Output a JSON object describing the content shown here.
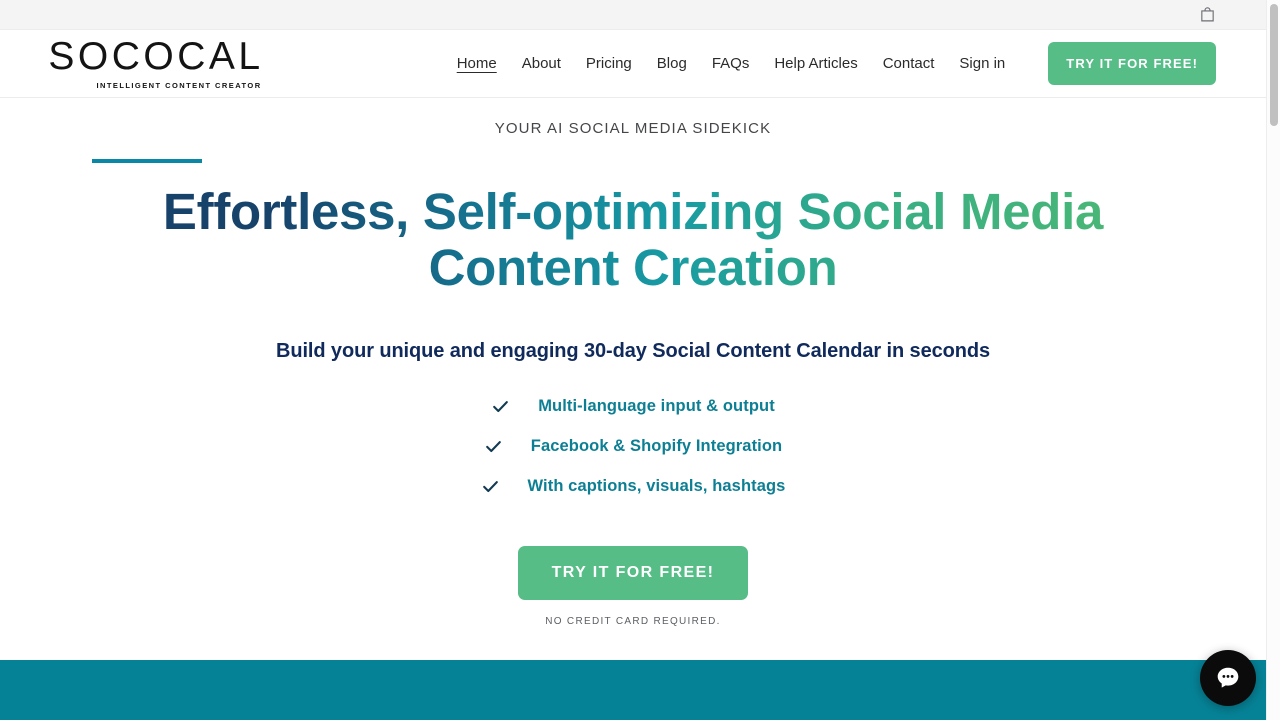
{
  "utility_bar": {
    "cart_icon": "shopping-bag-icon"
  },
  "header": {
    "brand": {
      "word": "SOCOCAL",
      "tagline": "INTELLIGENT CONTENT CREATOR"
    },
    "nav": [
      {
        "label": "Home",
        "active": true
      },
      {
        "label": "About",
        "active": false
      },
      {
        "label": "Pricing",
        "active": false
      },
      {
        "label": "Blog",
        "active": false
      },
      {
        "label": "FAQs",
        "active": false
      },
      {
        "label": "Help Articles",
        "active": false
      },
      {
        "label": "Contact",
        "active": false
      },
      {
        "label": "Sign in",
        "active": false
      }
    ],
    "cta_label": "TRY IT FOR FREE!"
  },
  "hero": {
    "eyebrow": "YOUR AI SOCIAL MEDIA SIDEKICK",
    "title": "Effortless, Self-optimizing Social Media Content Creation",
    "subtitle": "Build your unique and engaging 30-day Social Content Calendar in seconds",
    "features": [
      {
        "icon": "check-icon",
        "label": "Multi-language input & output"
      },
      {
        "icon": "check-icon",
        "label": "Facebook & Shopify Integration"
      },
      {
        "icon": "check-icon",
        "label": "With captions, visuals, hashtags"
      }
    ],
    "cta_label": "TRY IT FOR FREE!",
    "cta_note": "NO CREDIT CARD REQUIRED."
  },
  "chat": {
    "icon": "chat-bubble-icon"
  },
  "colors": {
    "brand_green": "#56bd87",
    "accent_teal": "#0a87a4",
    "band_teal": "#068296",
    "heading_navy": "#17436b",
    "heading_green": "#4fb972",
    "feature_teal": "#0d7f94",
    "subtitle_navy": "#112a5c"
  }
}
